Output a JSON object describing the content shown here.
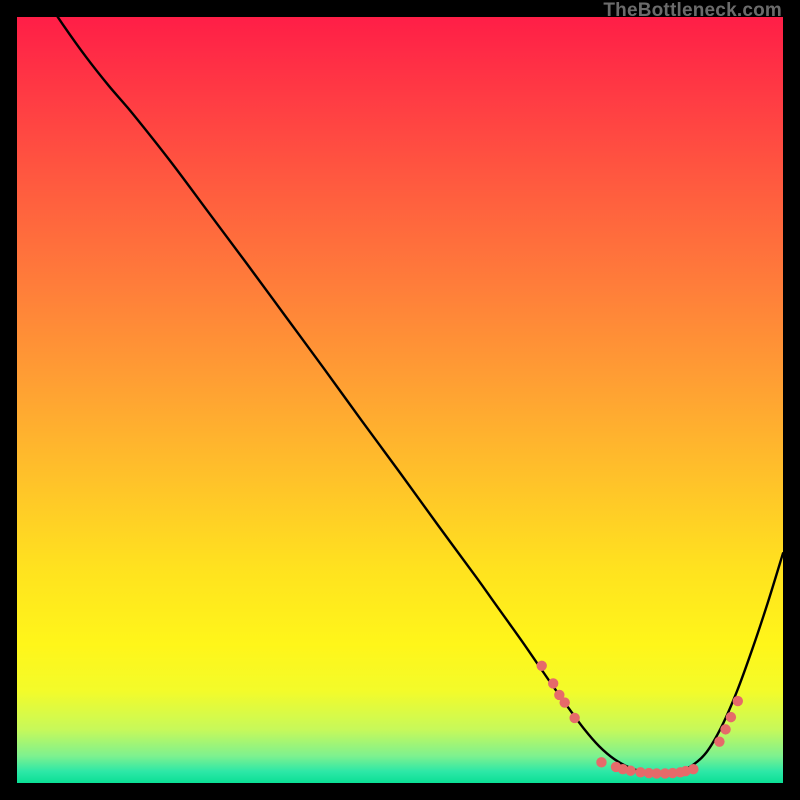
{
  "watermark": "TheBottleneck.com",
  "chart_data": {
    "type": "line",
    "title": "",
    "xlabel": "",
    "ylabel": "",
    "xlim": [
      0,
      100
    ],
    "ylim": [
      0,
      100
    ],
    "series": [
      {
        "name": "curve",
        "x": [
          0,
          3,
          6,
          9,
          12,
          15,
          20,
          25,
          30,
          35,
          40,
          45,
          50,
          55,
          60,
          62,
          64,
          66,
          68,
          70,
          72,
          74,
          76,
          78,
          80,
          82,
          84,
          86,
          88,
          90,
          92,
          94,
          96,
          98,
          100
        ],
        "y": [
          108,
          103.5,
          99,
          94.8,
          91,
          87.5,
          81.2,
          74.5,
          67.8,
          61,
          54.2,
          47.3,
          40.5,
          33.6,
          26.8,
          24,
          21.2,
          18.4,
          15.5,
          12.6,
          9.8,
          7.1,
          4.8,
          3.1,
          2.0,
          1.4,
          1.2,
          1.4,
          2.2,
          4.0,
          7.4,
          12.0,
          17.5,
          23.5,
          30.0
        ]
      }
    ],
    "markers": {
      "name": "highlight-dots",
      "points": [
        {
          "x": 68.5,
          "y": 15.3
        },
        {
          "x": 70.0,
          "y": 13.0
        },
        {
          "x": 70.8,
          "y": 11.5
        },
        {
          "x": 71.5,
          "y": 10.5
        },
        {
          "x": 72.8,
          "y": 8.5
        },
        {
          "x": 76.3,
          "y": 2.7
        },
        {
          "x": 78.2,
          "y": 2.1
        },
        {
          "x": 79.1,
          "y": 1.8
        },
        {
          "x": 80.1,
          "y": 1.6
        },
        {
          "x": 81.4,
          "y": 1.4
        },
        {
          "x": 82.5,
          "y": 1.3
        },
        {
          "x": 83.5,
          "y": 1.25
        },
        {
          "x": 84.6,
          "y": 1.25
        },
        {
          "x": 85.6,
          "y": 1.3
        },
        {
          "x": 86.6,
          "y": 1.4
        },
        {
          "x": 87.3,
          "y": 1.55
        },
        {
          "x": 88.3,
          "y": 1.8
        },
        {
          "x": 91.7,
          "y": 5.4
        },
        {
          "x": 92.5,
          "y": 7.0
        },
        {
          "x": 93.2,
          "y": 8.6
        },
        {
          "x": 94.1,
          "y": 10.7
        }
      ]
    },
    "gradient_stops": [
      {
        "t": 0.0,
        "color": "#ff1e47"
      },
      {
        "t": 0.1,
        "color": "#ff3a44"
      },
      {
        "t": 0.22,
        "color": "#ff5b3f"
      },
      {
        "t": 0.35,
        "color": "#ff7d3a"
      },
      {
        "t": 0.48,
        "color": "#ffa033"
      },
      {
        "t": 0.6,
        "color": "#ffc12a"
      },
      {
        "t": 0.72,
        "color": "#ffe21f"
      },
      {
        "t": 0.82,
        "color": "#fff61a"
      },
      {
        "t": 0.88,
        "color": "#f3fb2a"
      },
      {
        "t": 0.93,
        "color": "#c7f95a"
      },
      {
        "t": 0.965,
        "color": "#7df18f"
      },
      {
        "t": 0.985,
        "color": "#2de8a7"
      },
      {
        "t": 1.0,
        "color": "#0adf95"
      }
    ]
  }
}
